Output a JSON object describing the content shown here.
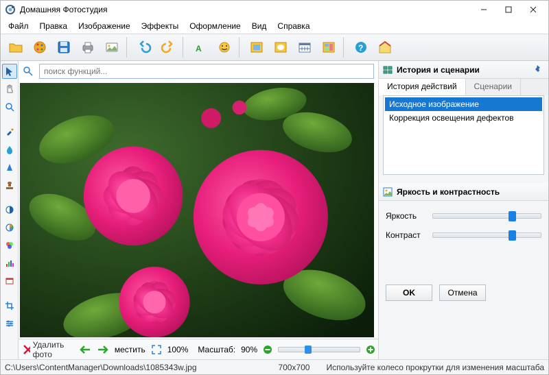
{
  "window": {
    "title": "Домашняя Фотостудия"
  },
  "menu": {
    "file": "Файл",
    "edit": "Правка",
    "image": "Изображение",
    "effects": "Эффекты",
    "design": "Оформление",
    "view": "Вид",
    "help": "Справка"
  },
  "toolbar": {
    "open": "open",
    "palette": "palette",
    "save": "save",
    "print": "print",
    "catalog": "catalog",
    "undo": "undo",
    "redo": "redo",
    "text": "text",
    "sticker": "sticker",
    "frame": "frame",
    "mask": "mask",
    "calendar": "calendar",
    "collage": "collage",
    "help": "help",
    "home": "home"
  },
  "search": {
    "placeholder": "поиск функций..."
  },
  "left_tools": [
    "pointer",
    "hand",
    "zoom",
    "brush",
    "drop",
    "triangle",
    "stamp",
    "contrast",
    "hue",
    "rgb",
    "histogram",
    "postcard",
    "crop",
    "levels"
  ],
  "bottom": {
    "delete_label": "Удалить фото",
    "fit_label": "местить",
    "fit_percent": "100%",
    "zoom_label": "Масштаб:",
    "zoom_value": "90%"
  },
  "right": {
    "panel1_title": "История и сценарии",
    "tab_history": "История действий",
    "tab_scenarios": "Сценарии",
    "history": [
      "Исходное изображение",
      "Коррекция освещения дефектов"
    ],
    "panel2_title": "Яркость и контрастность",
    "brightness_label": "Яркость",
    "contrast_label": "Контраст",
    "ok": "OK",
    "cancel": "Отмена"
  },
  "status": {
    "path": "C:\\Users\\ContentManager\\Downloads\\1085343w.jpg",
    "dimensions": "700x700",
    "hint": "Используйте колесо прокрутки для изменения масштаба"
  }
}
